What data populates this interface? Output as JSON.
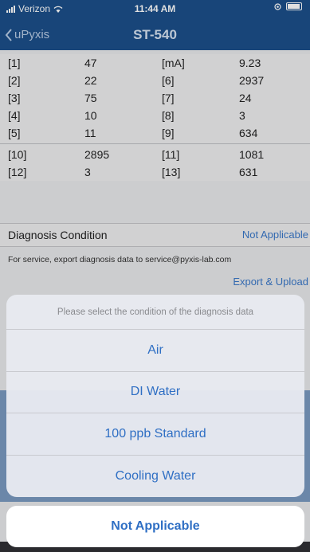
{
  "status_bar": {
    "carrier": "Verizon",
    "time": "11:44 AM"
  },
  "nav": {
    "back_label": "uPyxis",
    "title": "ST-540"
  },
  "table": {
    "rows_top": [
      [
        "[1]",
        "47",
        "[mA]",
        "9.23"
      ],
      [
        "[2]",
        "22",
        "[6]",
        "2937"
      ],
      [
        "[3]",
        "75",
        "[7]",
        "24"
      ],
      [
        "[4]",
        "10",
        "[8]",
        "3"
      ],
      [
        "[5]",
        "11",
        "[9]",
        "634"
      ]
    ],
    "rows_bottom": [
      [
        "[10]",
        "2895",
        "[11]",
        "1081"
      ],
      [
        "[12]",
        "3",
        "[13]",
        "631"
      ]
    ]
  },
  "diagnosis": {
    "label": "Diagnosis Condition",
    "value": "Not Applicable"
  },
  "note": "For service, export diagnosis data to service@pyxis-lab.com",
  "export_label": "Export & Upload",
  "sheet": {
    "title": "Please select the condition of the diagnosis data",
    "options": [
      "Air",
      "DI Water",
      "100 ppb Standard",
      "Cooling Water"
    ],
    "cancel_label": "Not Applicable"
  },
  "colors": {
    "header": "#1c4f8a",
    "accent": "#2f6fc4"
  }
}
